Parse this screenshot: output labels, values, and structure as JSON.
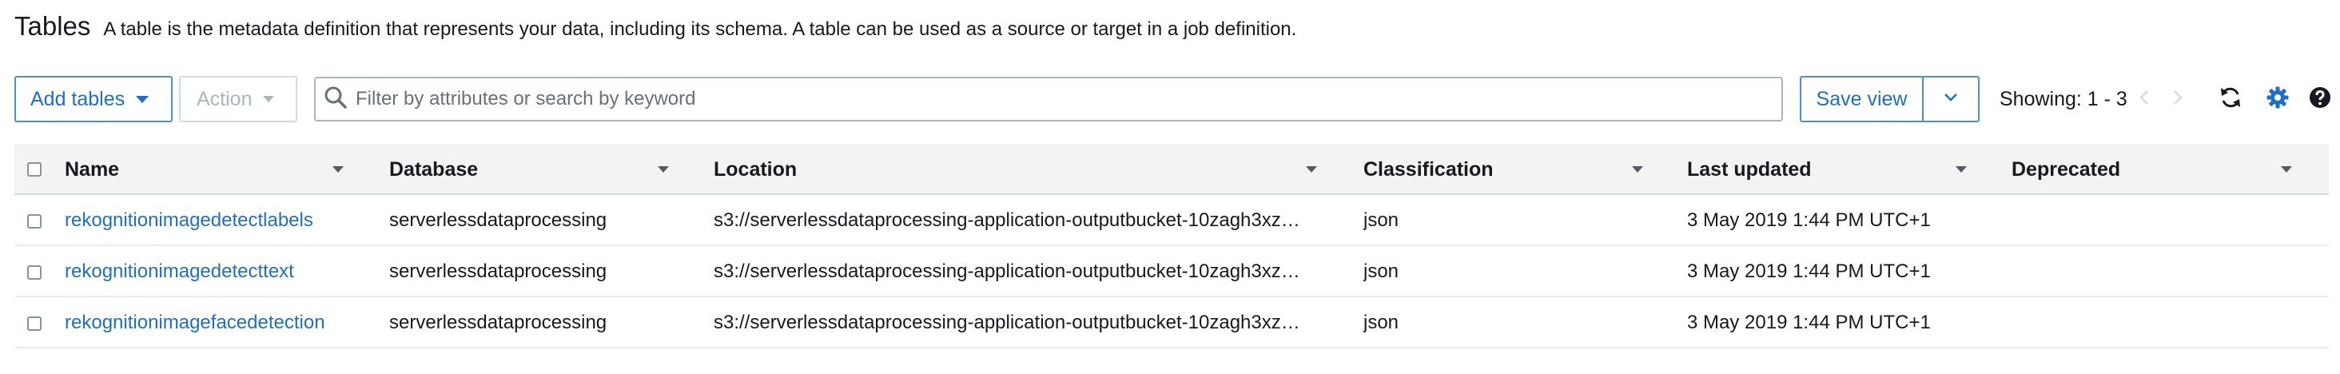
{
  "header": {
    "title": "Tables",
    "description": "A table is the metadata definition that represents your data, including its schema. A table can be used as a source or target in a job definition."
  },
  "toolbar": {
    "add_tables_label": "Add tables",
    "action_label": "Action",
    "search_placeholder": "Filter by attributes or search by keyword",
    "search_value": "",
    "save_view_label": "Save view",
    "showing_label": "Showing: 1 - 3",
    "icons": [
      "search-icon",
      "chevron-down-icon",
      "previous-page-icon",
      "next-page-icon",
      "refresh-icon",
      "gear-icon",
      "help-icon"
    ]
  },
  "table": {
    "columns": [
      "Name",
      "Database",
      "Location",
      "Classification",
      "Last updated",
      "Deprecated"
    ],
    "rows": [
      {
        "name": "rekognitionimagedetectlabels",
        "database": "serverlessdataprocessing",
        "location": "s3://serverlessdataprocessing-application-outputbucket-10zagh3xz…",
        "classification": "json",
        "last_updated": "3 May 2019 1:44 PM UTC+1",
        "deprecated": ""
      },
      {
        "name": "rekognitionimagedetecttext",
        "database": "serverlessdataprocessing",
        "location": "s3://serverlessdataprocessing-application-outputbucket-10zagh3xz…",
        "classification": "json",
        "last_updated": "3 May 2019 1:44 PM UTC+1",
        "deprecated": ""
      },
      {
        "name": "rekognitionimagefacedetection",
        "database": "serverlessdataprocessing",
        "location": "s3://serverlessdataprocessing-application-outputbucket-10zagh3xz…",
        "classification": "json",
        "last_updated": "3 May 2019 1:44 PM UTC+1",
        "deprecated": ""
      }
    ]
  },
  "colors": {
    "link": "#1f6fc5",
    "button_border": "#4a90d9",
    "header_bg": "#f2f3f3",
    "disabled": "#aab7b8",
    "gear": "#1f6fc5"
  }
}
